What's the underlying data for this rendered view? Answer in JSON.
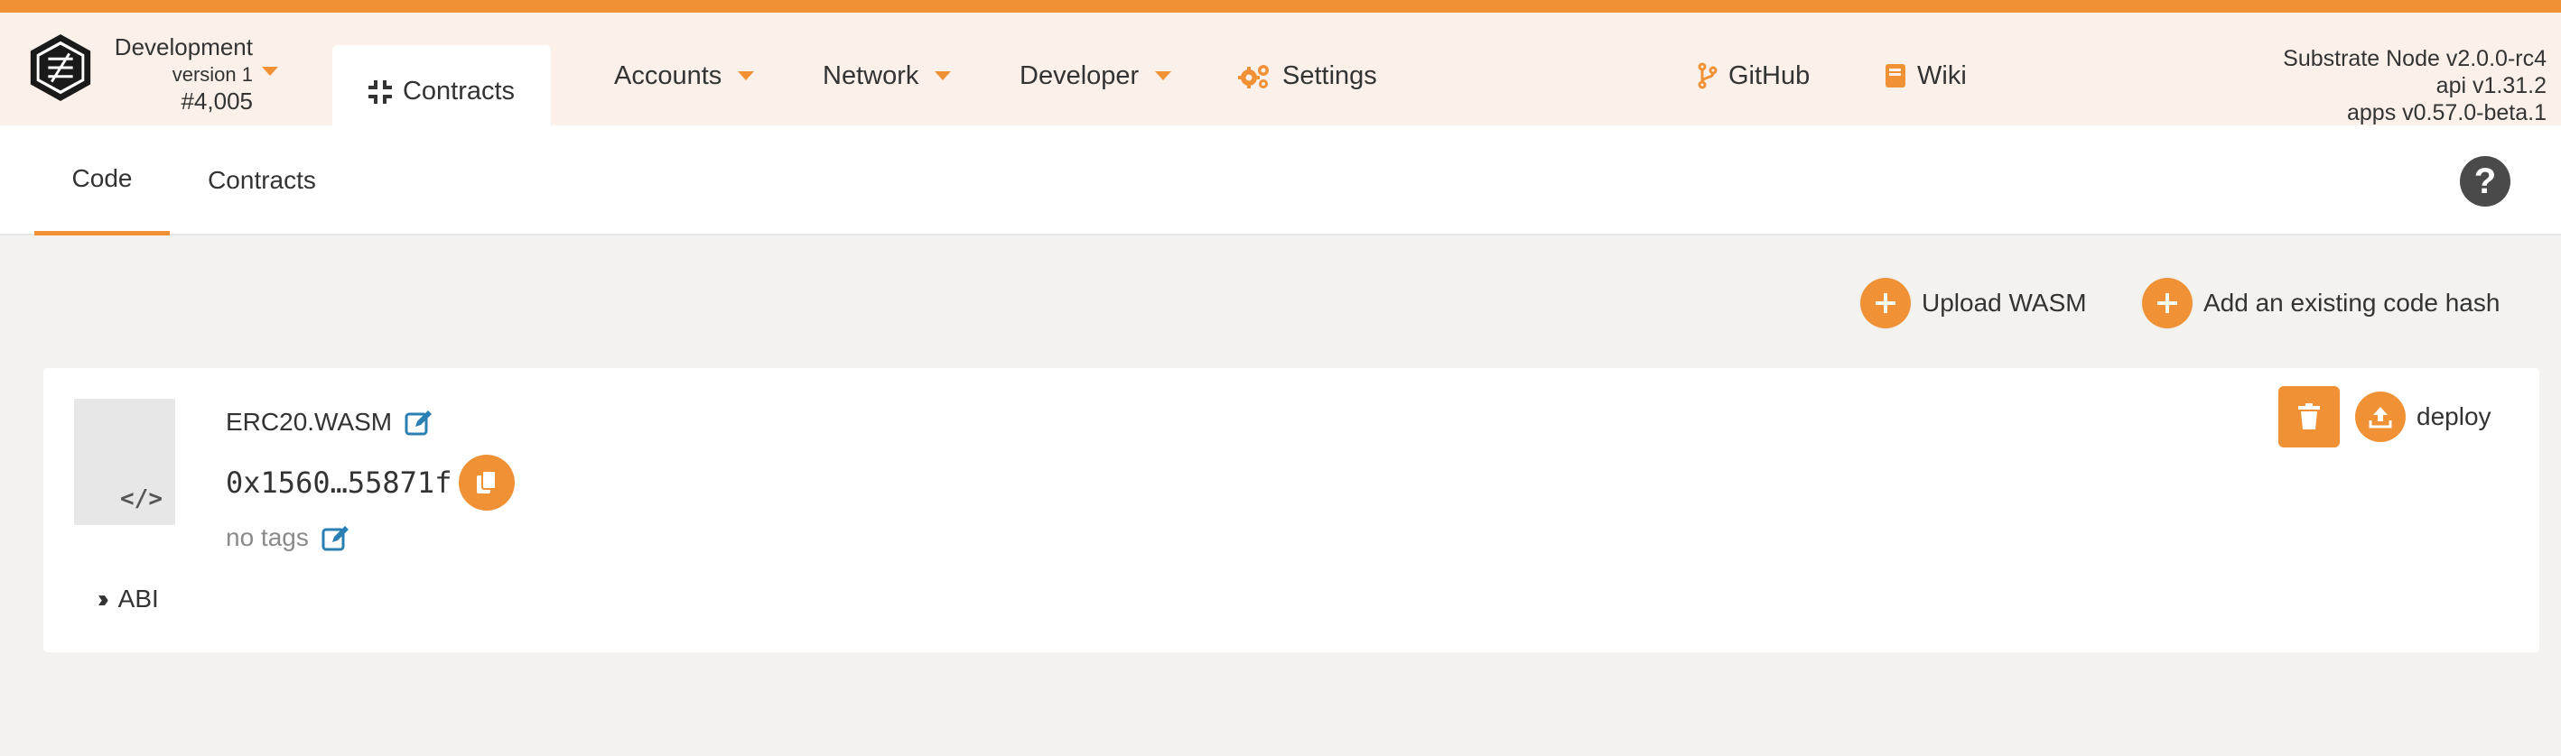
{
  "colors": {
    "accent": "#f19135",
    "menubar_bg": "#fcf1ea",
    "page_bg": "#f3f2f1",
    "edit_blue": "#2a7fb3"
  },
  "chain": {
    "name": "Development",
    "version": "version 1",
    "block": "#4,005"
  },
  "nav": {
    "items": [
      {
        "label": "Contracts",
        "icon": "compress-icon",
        "active": true
      },
      {
        "label": "Accounts",
        "dropdown": true
      },
      {
        "label": "Network",
        "dropdown": true
      },
      {
        "label": "Developer",
        "dropdown": true
      },
      {
        "label": "Settings",
        "icon": "gears-icon"
      },
      {
        "label": "GitHub",
        "icon": "code-branch-icon"
      },
      {
        "label": "Wiki",
        "icon": "book-icon"
      }
    ]
  },
  "node": {
    "line1": "Substrate Node v2.0.0-rc4",
    "line2": "api v1.31.2",
    "line3": "apps v0.57.0-beta.1"
  },
  "tabs": [
    {
      "label": "Code",
      "active": true
    },
    {
      "label": "Contracts",
      "active": false
    }
  ],
  "help": {
    "icon": "question-circle-icon",
    "symbol": "?"
  },
  "actions": {
    "upload_label": "Upload WASM",
    "add_hash_label": "Add an existing code hash"
  },
  "code_card": {
    "name": "ERC20.WASM",
    "hash": "0x1560…55871f",
    "tags": "no tags",
    "abi_label": "ABI",
    "deploy_label": "deploy",
    "thumb_icon": "code-icon",
    "thumb_symbol": "</>"
  }
}
